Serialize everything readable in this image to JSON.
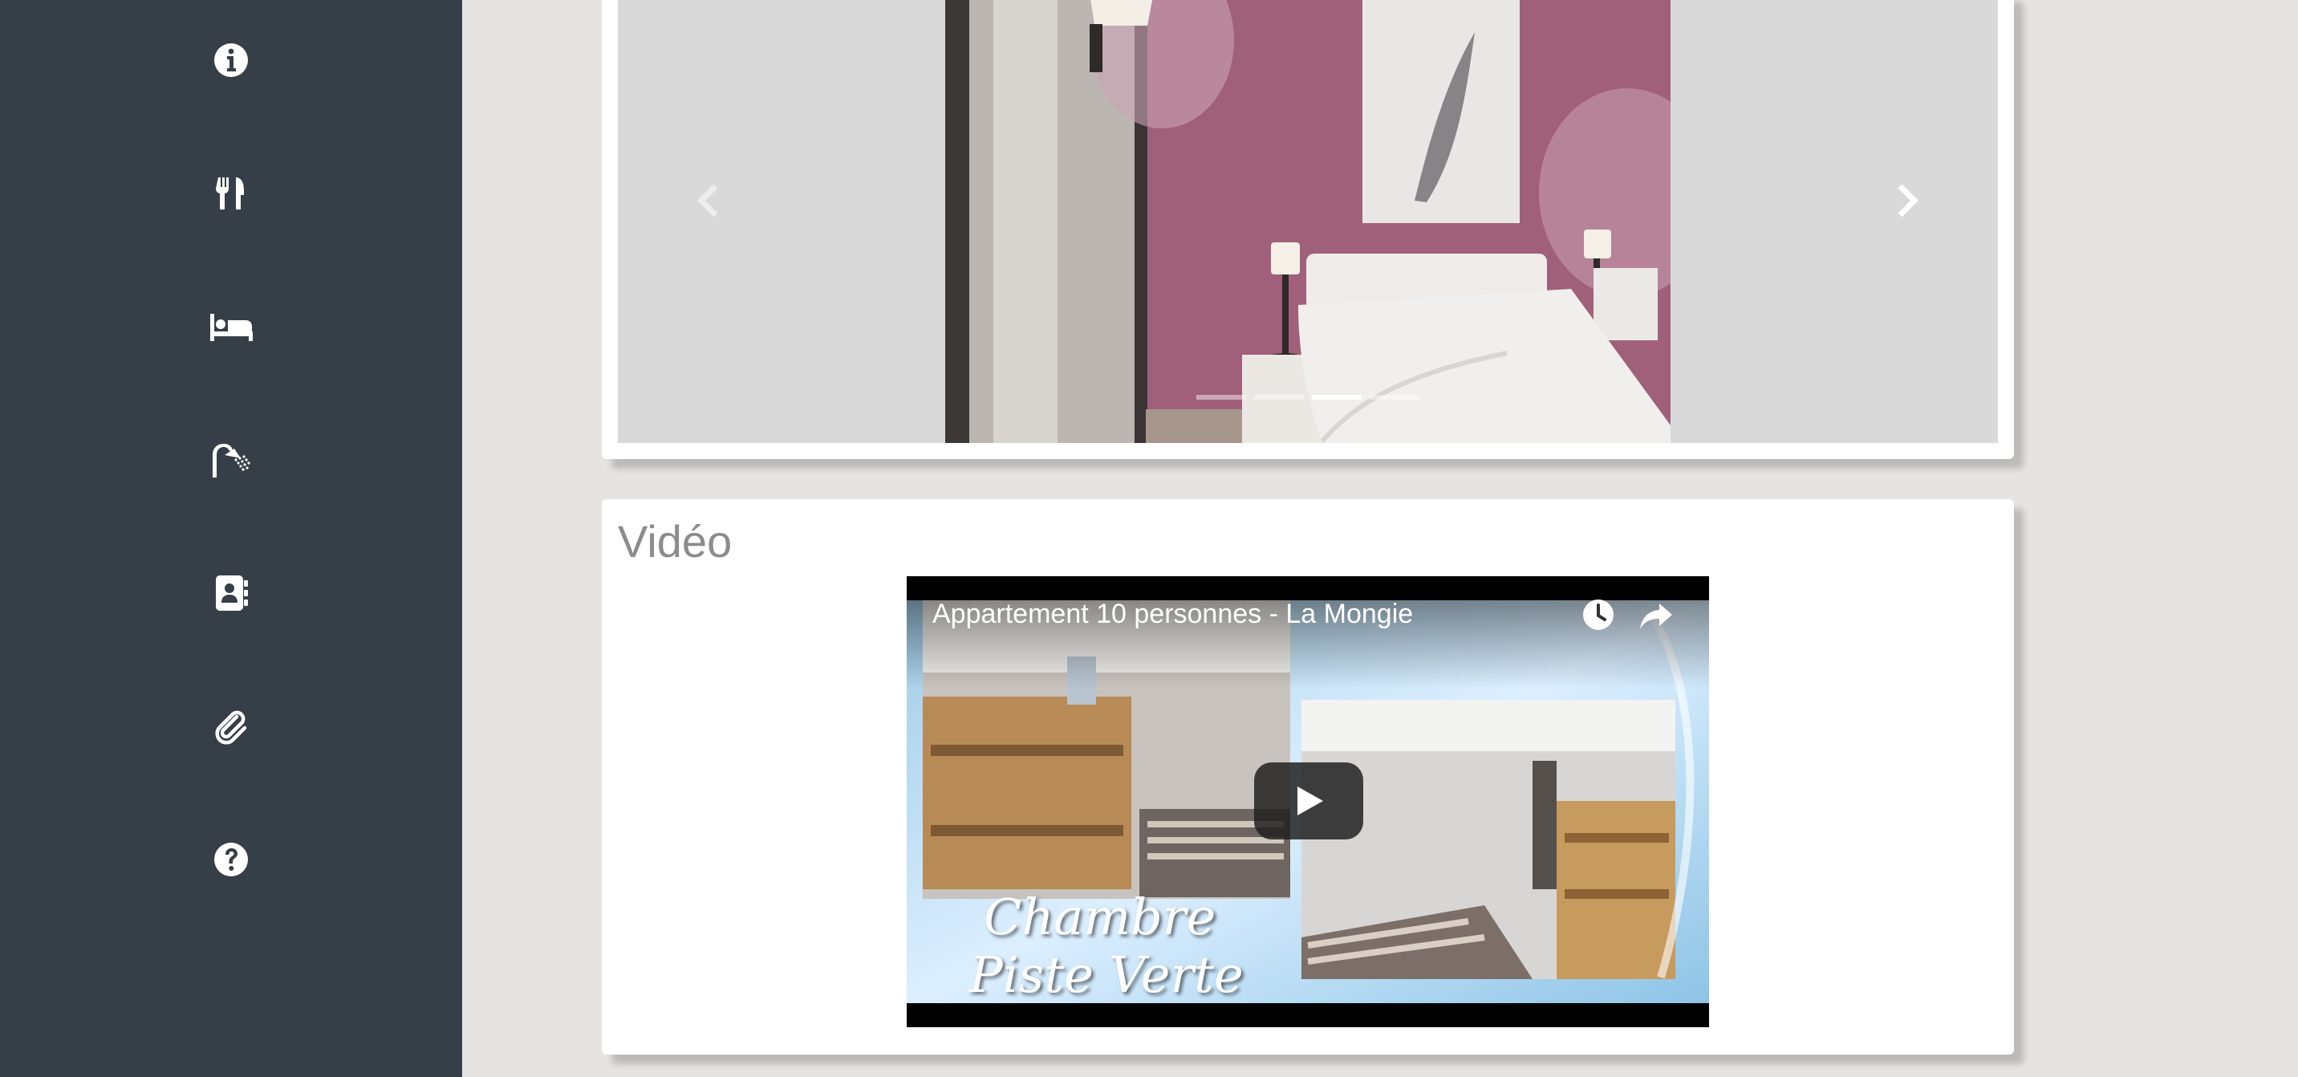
{
  "sidebar": {
    "items": [
      {
        "icon": "info-icon"
      },
      {
        "icon": "restaurant-icon"
      },
      {
        "icon": "bed-icon"
      },
      {
        "icon": "shower-icon"
      },
      {
        "icon": "contact-book-icon"
      },
      {
        "icon": "paperclip-icon"
      },
      {
        "icon": "help-icon"
      }
    ]
  },
  "carousel": {
    "prev_icon": "chevron-left-icon",
    "next_icon": "chevron-right-icon",
    "slide_count": 4,
    "active_index": 2
  },
  "video_section": {
    "title": "Vidéo",
    "video": {
      "caption": "Appartement 10 personnes - La Mongie",
      "overlay_line1": "Chambre",
      "overlay_line2": "Piste Verte",
      "watch_later_icon": "clock-icon",
      "share_icon": "share-icon",
      "play_icon": "play-icon"
    }
  },
  "colors": {
    "sidebar_bg": "#363e47",
    "page_bg": "#e5e4e2",
    "card_bg": "#ffffff",
    "title_text": "#8c8c8c",
    "bedroom_wall": "#a0607a"
  }
}
